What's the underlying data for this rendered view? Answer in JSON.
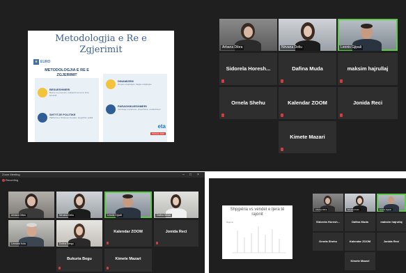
{
  "top_panel": {
    "slide": {
      "title": "Metodologjia e Re e\nZgjerimit",
      "logo_text": "EURO",
      "subtitle": "METODOLOGJIA E RE E ZGJERIMIT",
      "items": [
        {
          "heading": "BESUESHMERI",
          "text": "Besim ne procesin; mekanizma me te forte kontrolli"
        },
        {
          "heading": "SHTYTJE POLITIKE",
          "text": "Platforma e Shteteve Anetare; angazhim politik"
        },
        {
          "heading": "DINAMIZEM",
          "text": "Grupet e kapitujve; hapja e kapitujve"
        },
        {
          "heading": "PARASHIKUESHMERI",
          "text": "Vendosje e kritereve; shperblime; rrezikshmeri"
        }
      ],
      "logo2": "eta",
      "tag": "TIRANA 2020"
    },
    "video_tiles": [
      {
        "name": "Arbana Dibra"
      },
      {
        "name": "Nirvana Deliu"
      },
      {
        "name": "Leonis Gjipali"
      }
    ],
    "name_tiles": [
      "Sidorela Horesh...",
      "Dafina Muda",
      "maksim hajrullaj",
      "Ornela Shehu",
      "Kalendar ZOOM",
      "Jonida Reci",
      "Kimete Mazari"
    ]
  },
  "bottom_left": {
    "window_title": "Zoom Meeting",
    "recording_label": "Recording",
    "window_controls": [
      "–",
      "□",
      "×"
    ],
    "video_tiles": [
      {
        "name": "Arbana Dibra"
      },
      {
        "name": "Nirvana Deliu"
      },
      {
        "name": "Leonis Gjipali"
      },
      {
        "name": "Dafina Muda"
      },
      {
        "name": "Leonard Kola"
      },
      {
        "name": "Dorina Bregu"
      }
    ],
    "name_tiles": [
      "Kalendar ZOOM",
      "Jonida Reci",
      "Bukuria Begu",
      "Kimete Mazari"
    ]
  },
  "bottom_right": {
    "chart_slide": {
      "title": "Shpjpëria vs vendet e tjera të\nrajonit",
      "legend": "Rajonin"
    },
    "video_tiles": [
      {
        "name": "Arbana Dibra"
      },
      {
        "name": "Nirvana Deliu"
      },
      {
        "name": "Leonis Gjipali"
      }
    ],
    "name_tiles": [
      "Sidorela Horesh...",
      "Dafina Muda",
      "maksim hajrullaj",
      "Ornela Shehu",
      "Kalendar ZOOM",
      "Jonida Reci",
      "Kimete Mazari"
    ]
  },
  "colors": {
    "background": "#1f1f1f",
    "tile": "#2e2e2e",
    "active_speaker": "#5fc94a",
    "mic_muted": "#d23d3d",
    "slide_title": "#3d5f9a"
  }
}
